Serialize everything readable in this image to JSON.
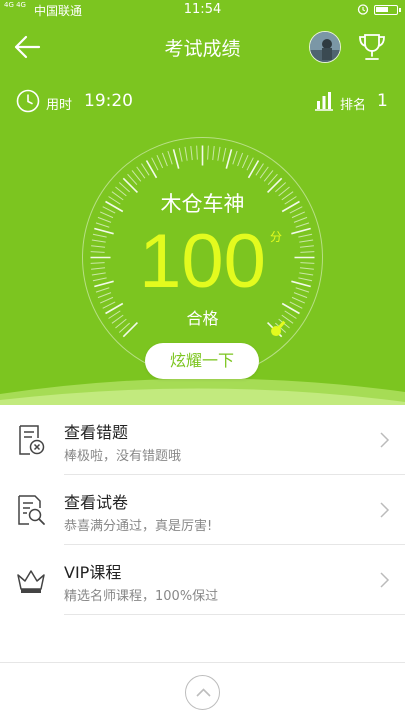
{
  "status_bar": {
    "network": "4G 4G",
    "carrier": "中国联通",
    "time": "11:54"
  },
  "header": {
    "title": "考试成绩",
    "back_icon": "back-arrow-icon",
    "avatar": "user-avatar",
    "trophy_icon": "trophy-icon"
  },
  "stats": {
    "time_label": "用时",
    "time_value": "19:20",
    "rank_label": "排名",
    "rank_value": "1"
  },
  "result": {
    "title": "木仓车神",
    "score": "100",
    "unit": "分",
    "status": "合格",
    "score_fraction": 1.0,
    "share_label": "炫耀一下"
  },
  "list": [
    {
      "icon": "error-sheet-icon",
      "title": "查看错题",
      "subtitle": "棒极啦，没有错题哦"
    },
    {
      "icon": "paper-search-icon",
      "title": "查看试卷",
      "subtitle": "恭喜满分通过，真是厉害!"
    },
    {
      "icon": "crown-icon",
      "title": "VIP课程",
      "subtitle": "精选名师课程，100%保过"
    }
  ],
  "colors": {
    "brand_green": "#7cc520",
    "score_yellow": "#e3fb1e"
  }
}
